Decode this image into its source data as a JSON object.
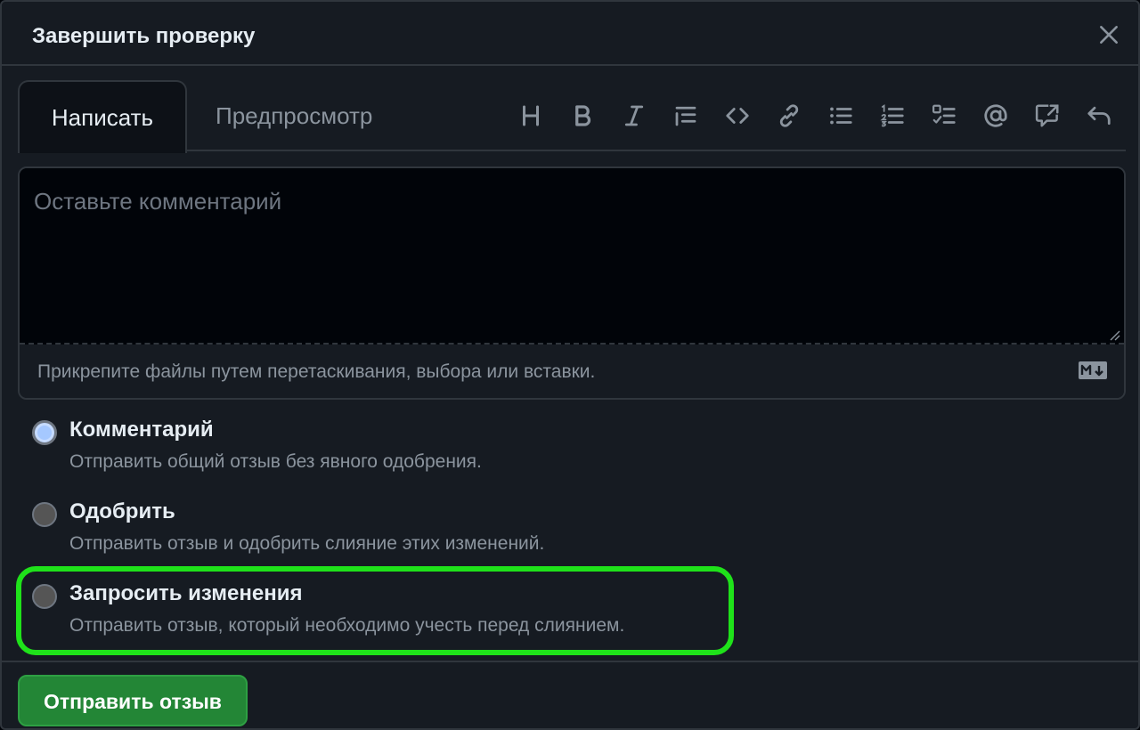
{
  "dialog": {
    "title": "Завершить проверку",
    "close_icon": "close-icon"
  },
  "tabs": {
    "write": "Написать",
    "preview": "Предпросмотр"
  },
  "toolbar": {
    "icons": [
      "heading-icon",
      "bold-icon",
      "italic-icon",
      "quote-icon",
      "code-icon",
      "link-icon",
      "bullet-list-icon",
      "numbered-list-icon",
      "task-list-icon",
      "mention-icon",
      "reference-icon",
      "undo-icon"
    ]
  },
  "editor": {
    "placeholder": "Оставьте комментарий",
    "value": "",
    "attach_hint": "Прикрепите файлы путем перетаскивания, выбора или вставки.",
    "markdown_icon": "markdown-icon"
  },
  "options": [
    {
      "title": "Комментарий",
      "description": "Отправить общий отзыв без явного одобрения.",
      "checked": true
    },
    {
      "title": "Одобрить",
      "description": "Отправить отзыв и одобрить слияние этих изменений.",
      "checked": false
    },
    {
      "title": "Запросить изменения",
      "description": "Отправить отзыв, который необходимо учесть перед слиянием.",
      "checked": false
    }
  ],
  "submit": {
    "label": "Отправить отзыв"
  },
  "colors": {
    "background": "#161b22",
    "textarea": "#010409",
    "border": "#30363d",
    "highlight": "#1fe21a",
    "submit": "#238636"
  }
}
